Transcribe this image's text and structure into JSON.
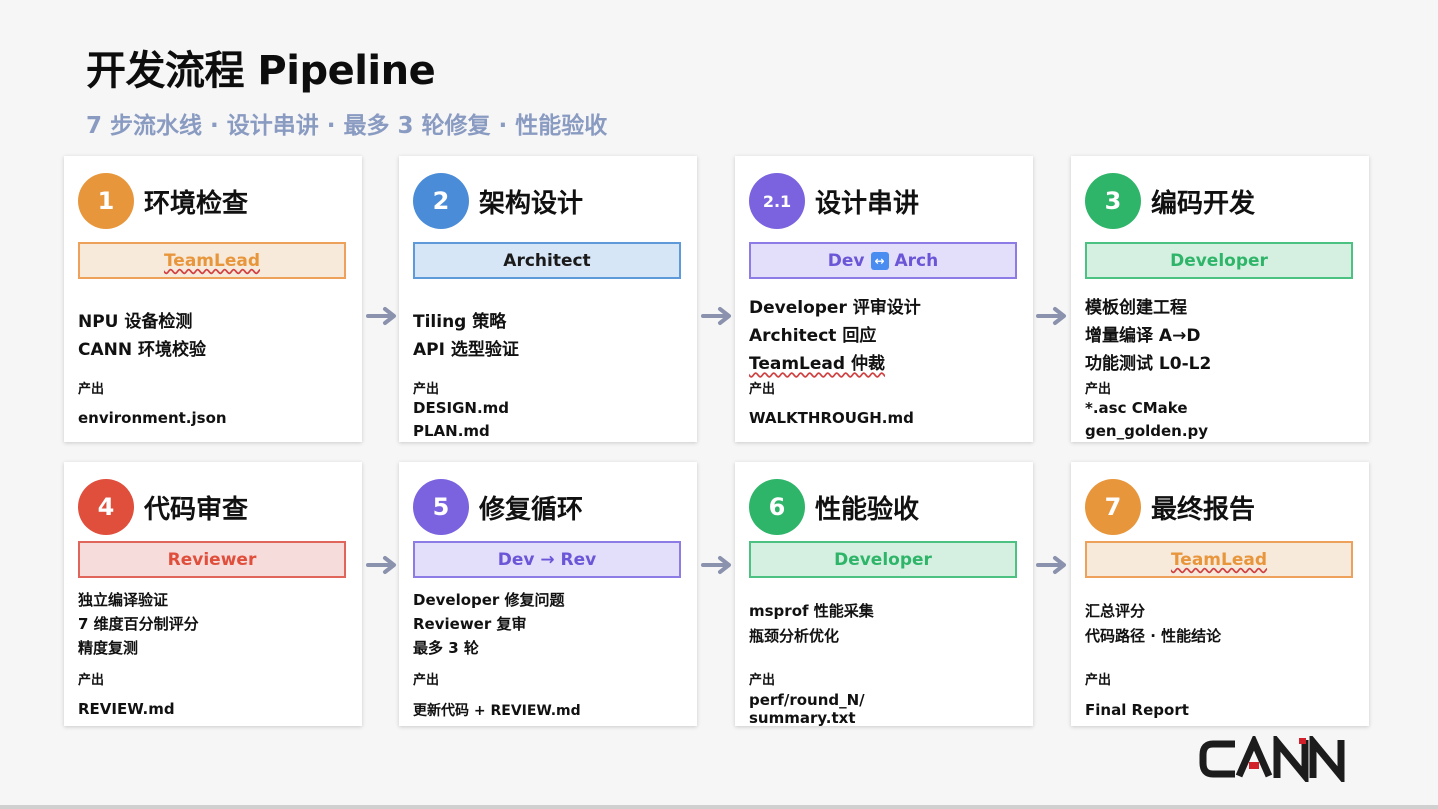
{
  "title": "开发流程 Pipeline",
  "subtitle": "7 步流水线 · 设计串讲 · 最多 3 轮修复 · 性能验收",
  "output_label": "产出",
  "logo_text": "CANN",
  "steps": [
    {
      "num": "1",
      "name": "环境检查",
      "role": "TeamLead",
      "tasks": [
        "NPU 设备检测",
        "CANN 环境校验"
      ],
      "outputs": [
        "environment.json"
      ],
      "color": "#e8963c",
      "role_bg": "#f8eadb",
      "role_border": "#eda15a",
      "role_color": "#e8963c"
    },
    {
      "num": "2",
      "name": "架构设计",
      "role": "Architect",
      "tasks": [
        "Tiling 策略",
        "API 选型验证"
      ],
      "outputs": [
        "DESIGN.md",
        "PLAN.md"
      ],
      "color": "#4a8cd8",
      "role_bg": "#d6e6f7",
      "role_border": "#5e9ad9",
      "role_color": "#1a1a1a"
    },
    {
      "num": "2.1",
      "name": "设计串讲",
      "role_left": "Dev",
      "role_right": "Arch",
      "tasks": [
        "Developer 评审设计",
        "Architect 回应",
        "TeamLead 仲裁"
      ],
      "outputs": [
        "WALKTHROUGH.md"
      ],
      "color": "#7b63e0",
      "role_bg": "#e3dffa",
      "role_border": "#8d7be6",
      "role_color": "#6b56d8"
    },
    {
      "num": "3",
      "name": "编码开发",
      "role": "Developer",
      "tasks": [
        "模板创建工程",
        "增量编译 A→D",
        "功能测试 L0-L2"
      ],
      "outputs": [
        "*.asc  CMake",
        "gen_golden.py"
      ],
      "color": "#2fb56a",
      "role_bg": "#d5f0e0",
      "role_border": "#4cc282",
      "role_color": "#2fb56a"
    },
    {
      "num": "4",
      "name": "代码审查",
      "role": "Reviewer",
      "tasks": [
        "独立编译验证",
        "7 维度百分制评分",
        "精度复测"
      ],
      "outputs": [
        "REVIEW.md"
      ],
      "color": "#e04e3c",
      "role_bg": "#f6dcdb",
      "role_border": "#e0655a",
      "role_color": "#e04e3c"
    },
    {
      "num": "5",
      "name": "修复循环",
      "role": "Dev → Rev",
      "tasks": [
        "Developer 修复问题",
        "Reviewer 复审",
        "最多 3 轮"
      ],
      "outputs": [
        "更新代码 + REVIEW.md"
      ],
      "color": "#7b63e0",
      "role_bg": "#e3dffa",
      "role_border": "#8d7be6",
      "role_color": "#6b56d8"
    },
    {
      "num": "6",
      "name": "性能验收",
      "role": "Developer",
      "tasks": [
        "msprof 性能采集",
        "瓶颈分析优化"
      ],
      "outputs": [
        "perf/round_N/",
        "summary.txt"
      ],
      "color": "#2fb56a",
      "role_bg": "#d5f0e0",
      "role_border": "#4cc282",
      "role_color": "#2fb56a"
    },
    {
      "num": "7",
      "name": "最终报告",
      "role": "TeamLead",
      "tasks": [
        "汇总评分",
        "代码路径 · 性能结论"
      ],
      "outputs": [
        "Final Report"
      ],
      "color": "#e8963c",
      "role_bg": "#f8eadb",
      "role_border": "#eda15a",
      "role_color": "#e8963c"
    }
  ]
}
